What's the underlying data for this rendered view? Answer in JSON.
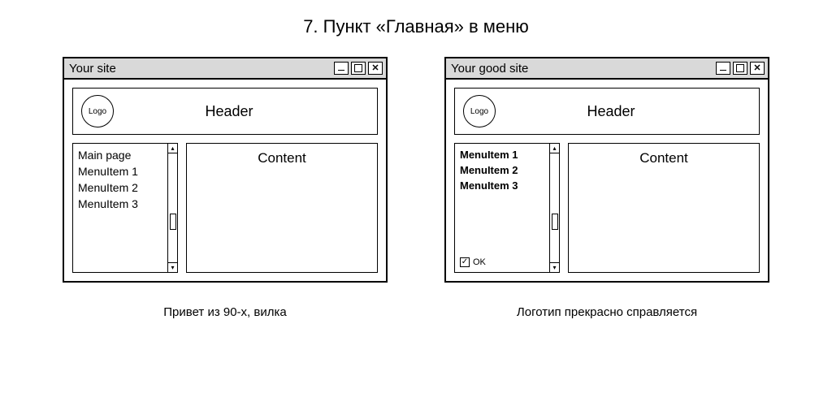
{
  "title": "7. Пункт «Главная» в меню",
  "left": {
    "window_title": "Your site",
    "logo_label": "Logo",
    "header_label": "Header",
    "content_label": "Content",
    "menu": [
      "Main page",
      "MenuItem 1",
      "MenuItem 2",
      "MenuItem 3"
    ],
    "caption": "Привет из 90-х, вилка"
  },
  "right": {
    "window_title": "Your good site",
    "logo_label": "Logo",
    "header_label": "Header",
    "content_label": "Content",
    "menu": [
      "MenuItem 1",
      "MenuItem 2",
      "MenuItem 3"
    ],
    "ok_label": "OK",
    "caption": "Логотип прекрасно справляется"
  }
}
